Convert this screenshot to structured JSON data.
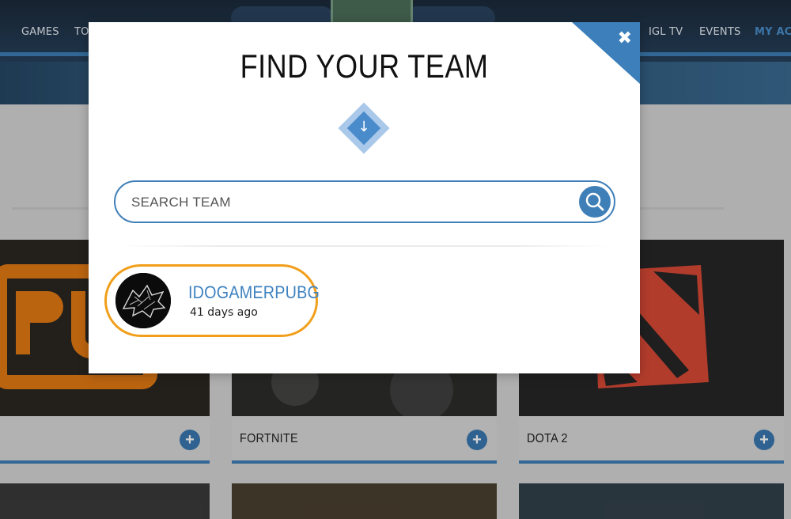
{
  "nav": {
    "items": [
      {
        "label": "GAMES"
      },
      {
        "label": "TOU"
      },
      {
        "label": "IGL TV"
      },
      {
        "label": "EVENTS"
      },
      {
        "label": "MY ACCO"
      }
    ],
    "accent_color": "#4a8fcc"
  },
  "games": [
    {
      "label": "",
      "icon": "pubg-logo"
    },
    {
      "label": "FORTNITE"
    },
    {
      "label": "DOTA 2",
      "icon": "dota-logo"
    }
  ],
  "modal": {
    "title": "FIND YOUR TEAM",
    "close_icon": "close-icon",
    "search": {
      "placeholder": "SEARCH TEAM",
      "value": "",
      "button_icon": "search-icon"
    },
    "results": [
      {
        "name": "IDOGAMERPUBG",
        "age": "41 days ago",
        "highlight_color": "#f19f1a",
        "avatar_icon": "wolf-avatar"
      }
    ]
  },
  "colors": {
    "primary_blue": "#3f7fb8",
    "highlight_orange": "#f19f1a"
  }
}
